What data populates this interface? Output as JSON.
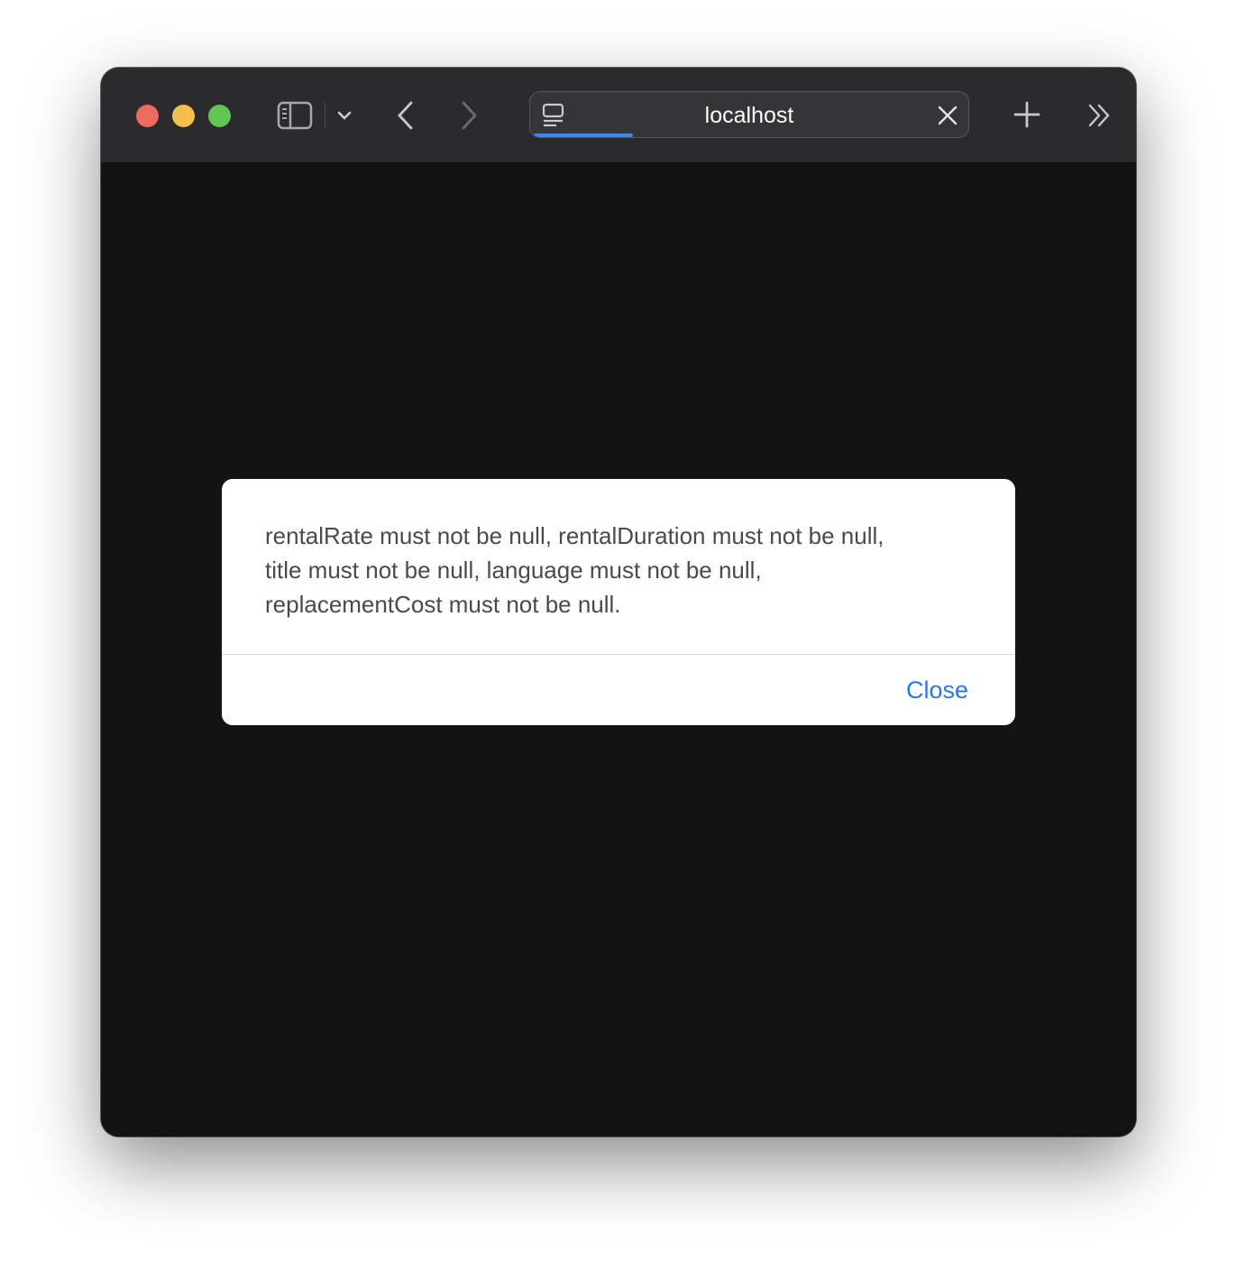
{
  "browser": {
    "address_bar": {
      "url": "localhost",
      "load_progress": 0.23
    },
    "icons": {
      "sidebar": "sidebar-icon",
      "dropdown": "chevron-down-icon",
      "back": "chevron-left-icon",
      "forward": "chevron-right-icon",
      "favicon": "tab-page-icon",
      "tab_close": "close-icon",
      "new_tab": "plus-icon",
      "more": "double-chevron-right-icon"
    },
    "colors": {
      "close": "#ec6a5e",
      "minimize": "#f4bf4f",
      "maximize": "#61c554",
      "progress": "#3d86f0"
    }
  },
  "dialog": {
    "message_lines": [
      "rentalRate must not be null, rentalDuration must not be null,",
      "title must not be null, language must not be null,",
      "replacementCost must not be null."
    ],
    "close_label": "Close",
    "accent_color": "#2a78e4"
  }
}
